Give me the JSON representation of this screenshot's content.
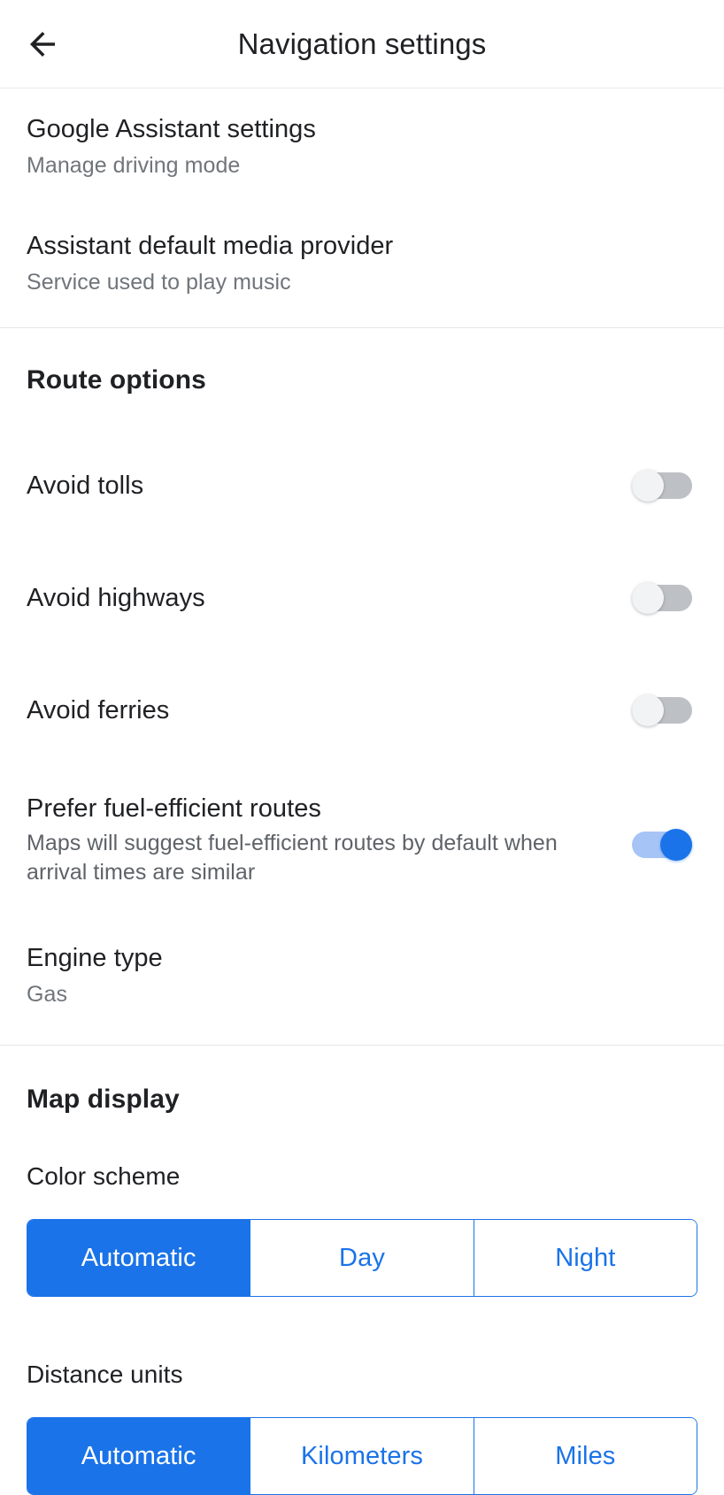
{
  "header": {
    "back_icon": "arrow-left-icon",
    "title": "Navigation settings"
  },
  "assistant_section": {
    "items": [
      {
        "title": "Google Assistant settings",
        "subtitle": "Manage driving mode"
      },
      {
        "title": "Assistant default media provider",
        "subtitle": "Service used to play music"
      }
    ]
  },
  "route_options": {
    "heading": "Route options",
    "toggles": [
      {
        "title": "Avoid tolls",
        "state": "off"
      },
      {
        "title": "Avoid highways",
        "state": "off"
      },
      {
        "title": "Avoid ferries",
        "state": "off"
      }
    ],
    "fuel_efficient": {
      "title": "Prefer fuel-efficient routes",
      "description": "Maps will suggest fuel-efficient routes by default when arrival times are similar",
      "state": "on"
    },
    "engine_type": {
      "title": "Engine type",
      "value": "Gas"
    }
  },
  "map_display": {
    "heading": "Map display",
    "color_scheme": {
      "label": "Color scheme",
      "options": [
        "Automatic",
        "Day",
        "Night"
      ],
      "selected": "Automatic"
    },
    "distance_units": {
      "label": "Distance units",
      "options": [
        "Automatic",
        "Kilometers",
        "Miles"
      ],
      "selected": "Automatic"
    }
  },
  "colors": {
    "accent": "#1a73e8",
    "text_primary": "#202124",
    "text_secondary": "#70757a",
    "toggle_off_track": "#bdc1c6",
    "toggle_on_track": "#a7c4f6"
  }
}
